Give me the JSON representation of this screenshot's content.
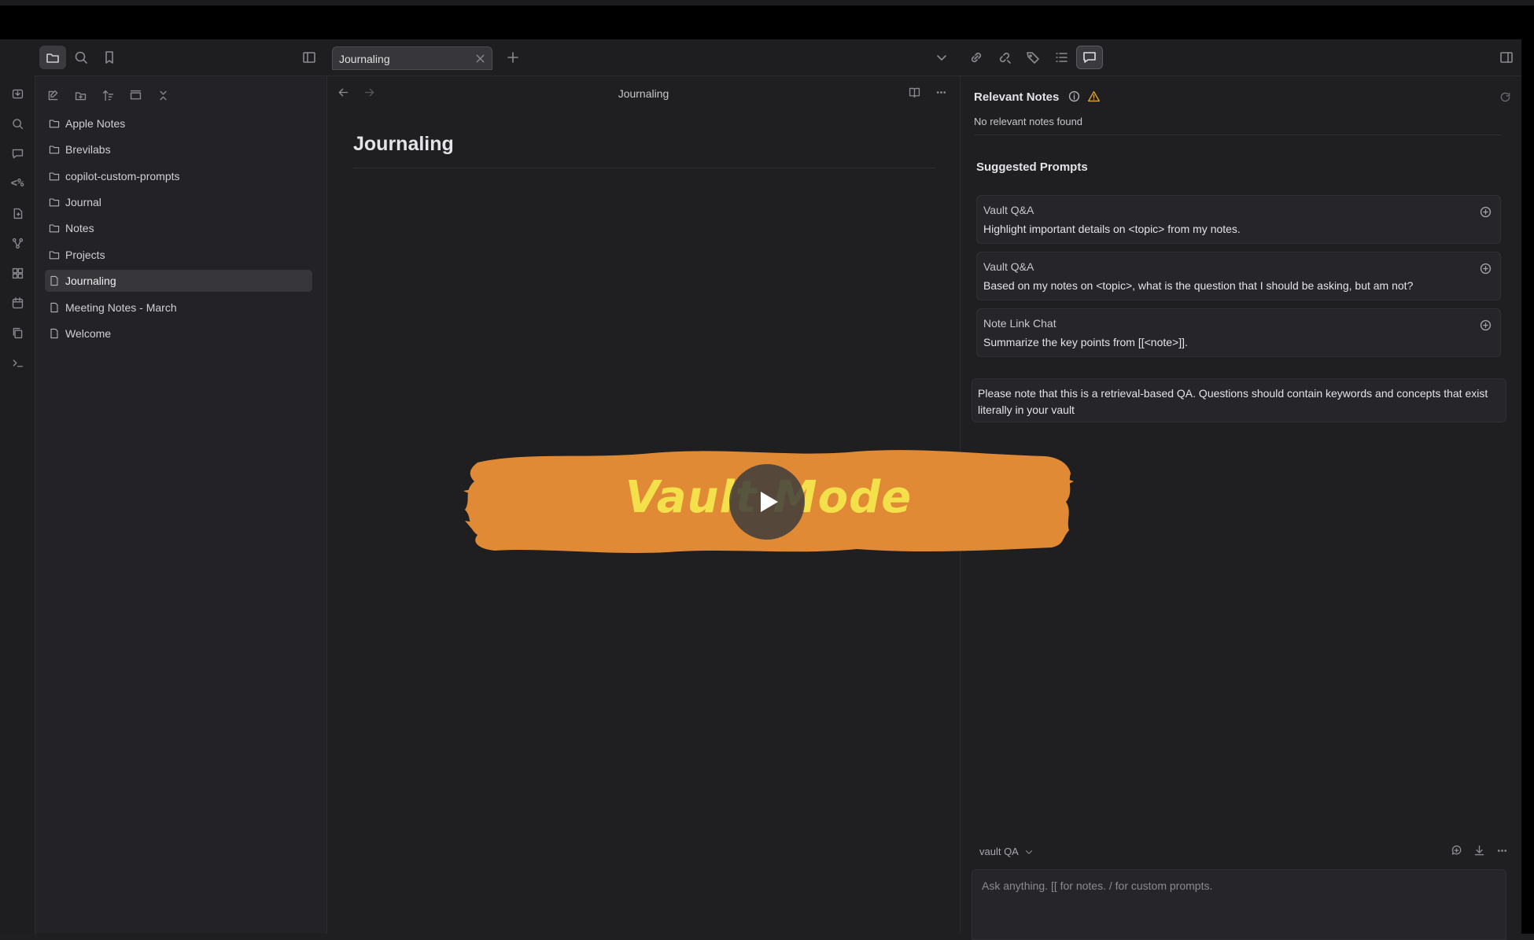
{
  "tabs": [
    {
      "title": "Journaling"
    }
  ],
  "file_tree": [
    {
      "type": "folder",
      "name": "Apple Notes"
    },
    {
      "type": "folder",
      "name": "Brevilabs"
    },
    {
      "type": "folder",
      "name": "copilot-custom-prompts"
    },
    {
      "type": "folder",
      "name": "Journal"
    },
    {
      "type": "folder",
      "name": "Notes"
    },
    {
      "type": "folder",
      "name": "Projects"
    },
    {
      "type": "file",
      "name": "Journaling",
      "selected": true
    },
    {
      "type": "file",
      "name": "Meeting Notes - March"
    },
    {
      "type": "file",
      "name": "Welcome"
    }
  ],
  "editor": {
    "view_title": "Journaling",
    "note_title": "Journaling"
  },
  "right_panel": {
    "relevant_title": "Relevant Notes",
    "relevant_empty": "No relevant notes found",
    "suggested_title": "Suggested Prompts",
    "prompts": [
      {
        "tag": "Vault Q&A",
        "text": "Highlight important details on <topic> from my notes."
      },
      {
        "tag": "Vault Q&A",
        "text": "Based on my notes on <topic>, what is the question that I should be asking, but am not?"
      },
      {
        "tag": "Note Link Chat",
        "text": "Summarize the key points from [[<note>]]."
      }
    ],
    "note": "Please note that this is a retrieval-based QA. Questions should contain keywords and concepts that exist literally in your vault",
    "mode": "vault QA",
    "input_placeholder": "Ask anything. [[ for notes. / for custom prompts."
  },
  "overlay": {
    "text": "Vault Mode"
  },
  "colors": {
    "banner": "#E08A35",
    "banner_text": "#F4E04A",
    "warning": "#E0A43A"
  }
}
